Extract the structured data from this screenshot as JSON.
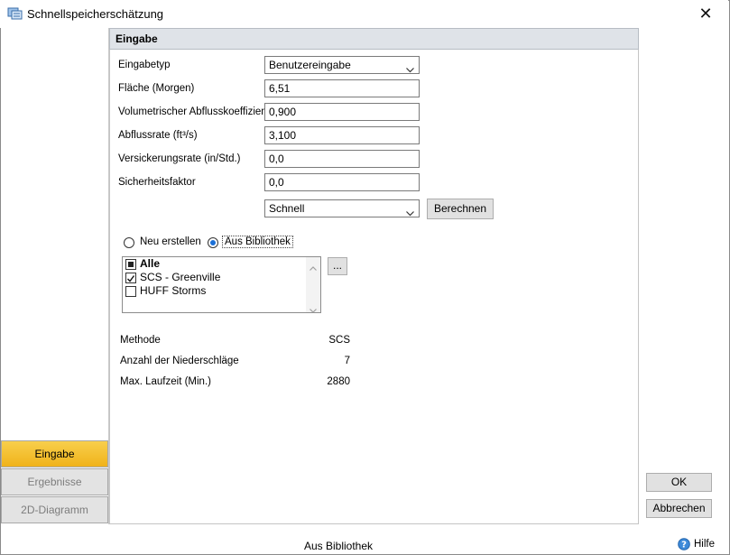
{
  "window": {
    "title": "Schnellspeicherschätzung"
  },
  "panel": {
    "header": "Eingabe"
  },
  "form": {
    "input_type_label": "Eingabetyp",
    "input_type_value": "Benutzereingabe",
    "area_label": "Fläche (Morgen)",
    "area_value": "6,51",
    "coeff_label": "Volumetrischer Abflusskoeffizient",
    "coeff_value": "0,900",
    "flow_label": "Abflussrate (ft³/s)",
    "flow_value": "3,100",
    "infiltration_label": "Versickerungsrate (in/Std.)",
    "infiltration_value": "0,0",
    "safety_label": "Sicherheitsfaktor",
    "safety_value": "0,0",
    "method_value": "Schnell",
    "compute_label": "Berechnen"
  },
  "source": {
    "new_label": "Neu erstellen",
    "library_label": "Aus Bibliothek",
    "selected": "library",
    "browse_label": "..."
  },
  "storms": {
    "items": [
      {
        "label": "Alle",
        "state": "partial",
        "bold": true
      },
      {
        "label": "SCS - Greenville",
        "state": "checked",
        "bold": false
      },
      {
        "label": "HUFF Storms",
        "state": "unchecked",
        "bold": false
      }
    ]
  },
  "info": {
    "method_label": "Methode",
    "method_value": "SCS",
    "count_label": "Anzahl der Niederschläge",
    "count_value": "7",
    "duration_label": "Max. Laufzeit (Min.)",
    "duration_value": "2880"
  },
  "sidebar": {
    "items": [
      {
        "label": "Eingabe",
        "active": true
      },
      {
        "label": "Ergebnisse",
        "active": false
      },
      {
        "label": "2D-Diagramm",
        "active": false
      }
    ]
  },
  "actions": {
    "ok_label": "OK",
    "cancel_label": "Abbrechen"
  },
  "status": {
    "text": "Aus Bibliothek",
    "help_label": "Hilfe"
  },
  "icons": {
    "app": "storage-app-icon",
    "close": "close-icon",
    "help": "help-icon"
  },
  "colors": {
    "accent": "#f5c023",
    "radio": "#1a6fd6",
    "header_bg": "#dfe3e8"
  }
}
